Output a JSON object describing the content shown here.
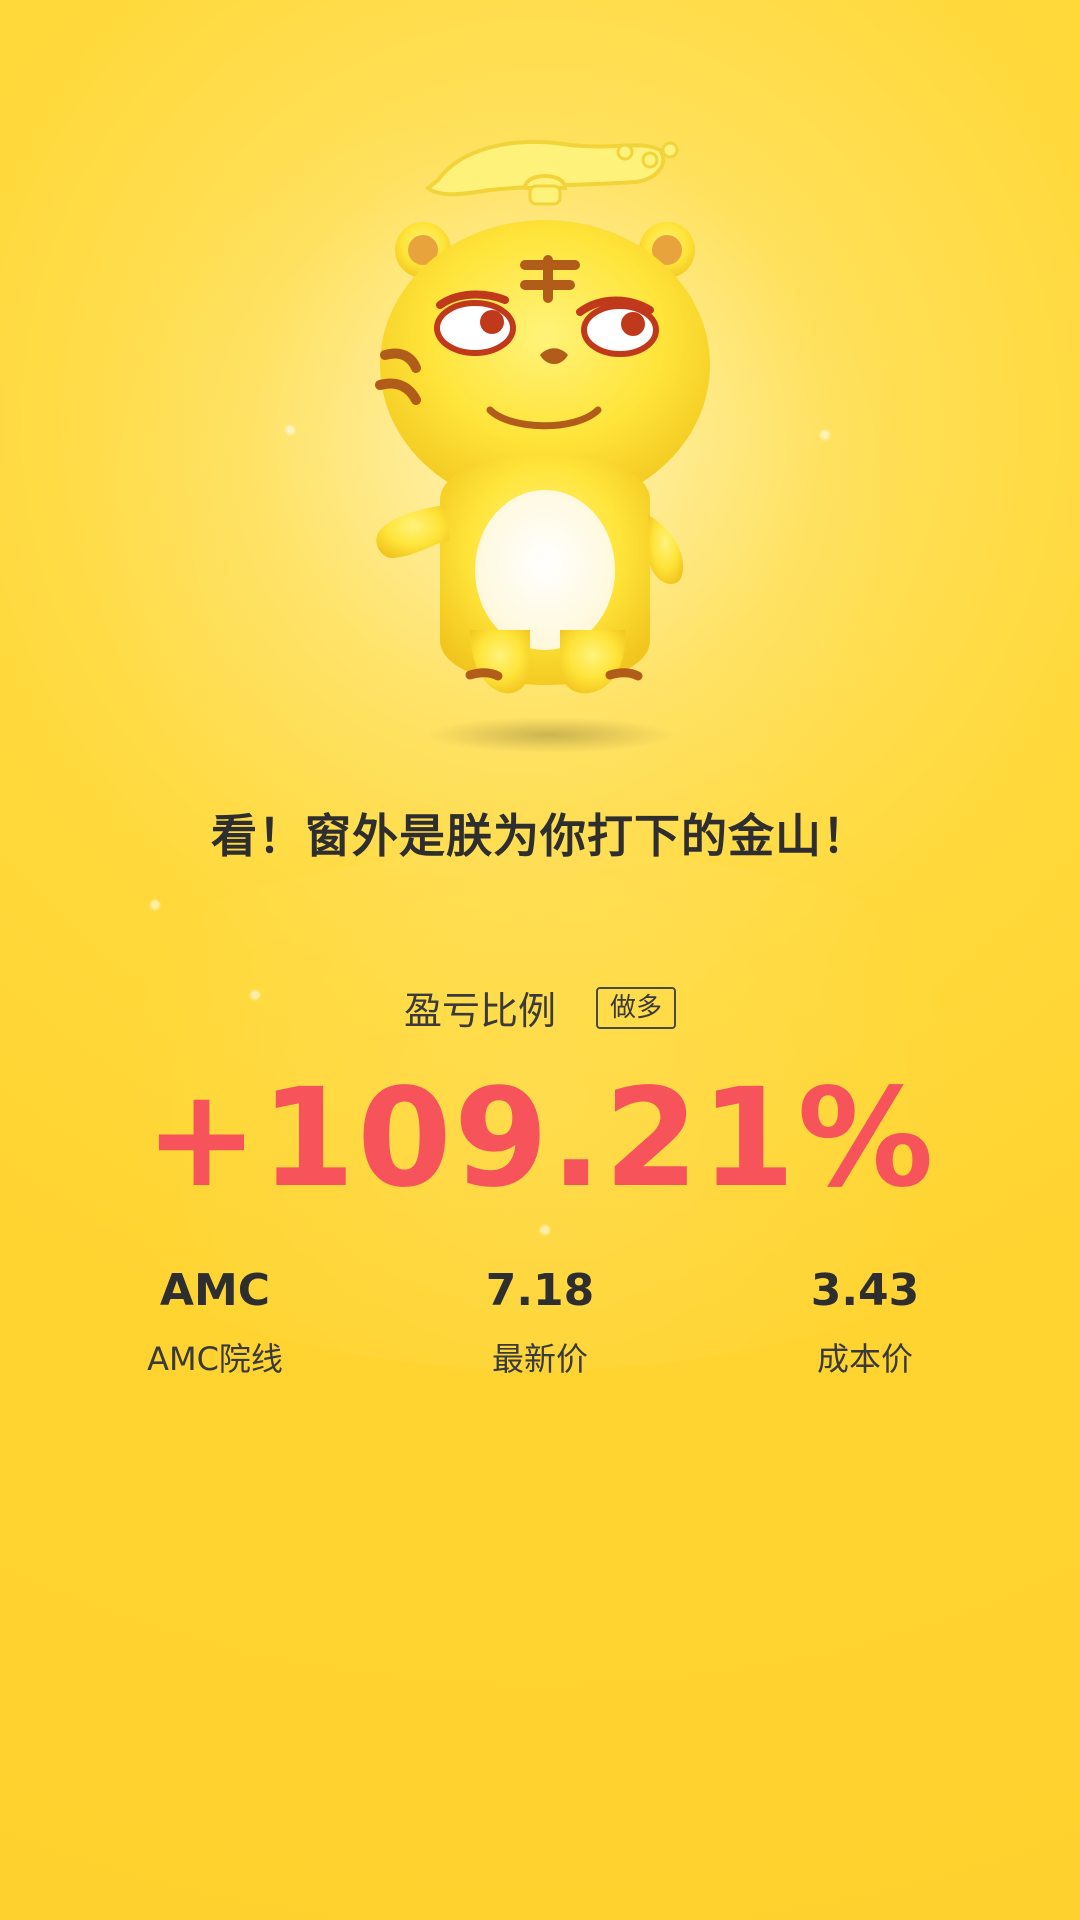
{
  "headline": "看！窗外是朕为你打下的金山！",
  "profit": {
    "label": "盈亏比例",
    "badge": "做多",
    "value": "+109.21%",
    "color": "#F6535A"
  },
  "stats": [
    {
      "value": "AMC",
      "label": "AMC院线"
    },
    {
      "value": "7.18",
      "label": "最新价"
    },
    {
      "value": "3.43",
      "label": "成本价"
    }
  ],
  "mascot": {
    "icon": "tiger-mascot-icon"
  },
  "colors": {
    "background": "#FFD431",
    "text_dark": "#2E2E2E",
    "accent_red": "#F6535A"
  }
}
